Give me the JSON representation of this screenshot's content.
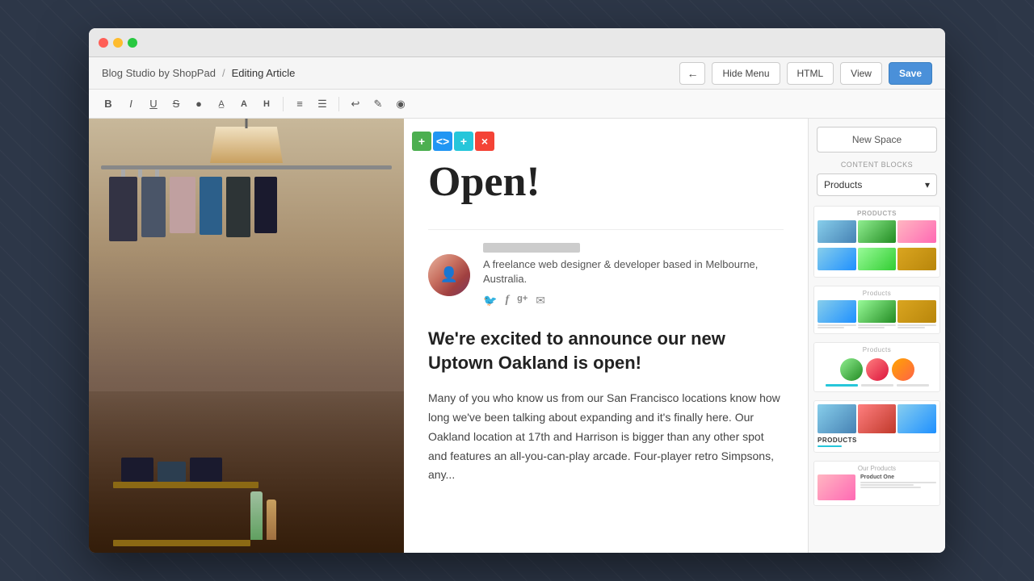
{
  "window": {
    "title": "Blog Studio by ShopPad",
    "breadcrumb_separator": "/",
    "breadcrumb_current": "Editing Article"
  },
  "navbar": {
    "app_name": "Blog Studio by ShopPad",
    "separator": "/",
    "current_page": "Editing Article",
    "back_button": "←",
    "hide_menu_label": "Hide Menu",
    "html_label": "HTML",
    "view_label": "View",
    "save_label": "Save"
  },
  "toolbar": {
    "buttons": [
      "B",
      "I",
      "U",
      "S",
      "●",
      "A̶",
      "A",
      "H",
      "≡",
      "≡",
      "↩",
      "✎",
      "◉"
    ]
  },
  "block_toolbar": {
    "add_label": "+",
    "code_label": "<>",
    "plus2_label": "+",
    "remove_label": "×"
  },
  "article": {
    "title": "Open!",
    "author_bio": "A freelance web designer & developer based in Melbourne, Australia.",
    "social_twitter": "🐦",
    "social_facebook": "f",
    "social_gplus": "g+",
    "social_email": "✉",
    "heading": "We're excited to announce our new Uptown Oakland is open!",
    "body": "Many of you who know us from our San Francisco locations know how long we've been talking about expanding and it's finally here. Our Oakland location at 17th and Harrison is bigger than any other spot and features an all-you-can-play arcade. Four-player retro Simpsons, any..."
  },
  "sidebar": {
    "new_space_label": "New Space",
    "content_blocks_label": "CONTENT BLOCKS",
    "dropdown_value": "Products",
    "block1_label": "PRODUCTS",
    "block2_label": "Products",
    "block3_label": "Products",
    "block4_label": "PRODUCTS",
    "block5_label": "Our Products",
    "chevron_down": "▾"
  }
}
